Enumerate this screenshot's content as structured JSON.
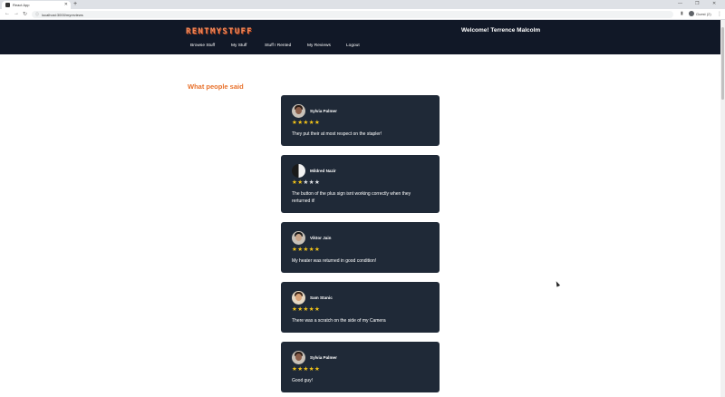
{
  "browser": {
    "tab_title": "React App",
    "url": "localhost:3000/myreviews",
    "profile": "Guest (2)"
  },
  "header": {
    "logo": "RENTMYSTUFF",
    "welcome": "Welcome! Terrence Malcolm",
    "nav": [
      "Browse Stuff",
      "My Stuff",
      "Stuff I Rented",
      "My Reviews",
      "Logout"
    ]
  },
  "page": {
    "title": "What people said"
  },
  "reviews": [
    {
      "name": "Sylvia Palmer",
      "rating": 5,
      "text": "They put their at most respect on the stapler!"
    },
    {
      "name": "Mildred Nazir",
      "rating": 2,
      "text": "The button of the plus sign isnt working correctly when they rerturned it!"
    },
    {
      "name": "Viktor Jain",
      "rating": 5,
      "text": "My heater was returned in good condition!"
    },
    {
      "name": "Sam Stanic",
      "rating": 5,
      "text": "There was a scratch on the side of my Camera"
    },
    {
      "name": "Sylvia Palmer",
      "rating": 5,
      "text": "Good guy!"
    }
  ],
  "colors": {
    "header_bg": "#111827",
    "card_bg": "#1f2937",
    "accent": "#e8702a",
    "star": "#f5c518"
  }
}
